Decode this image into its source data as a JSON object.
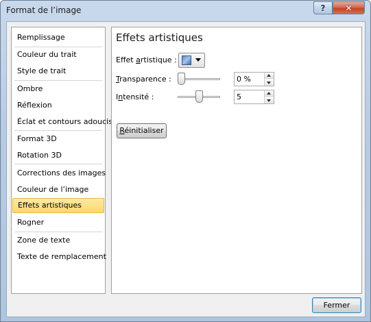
{
  "window": {
    "title": "Format de l’image",
    "help_glyph": "?",
    "close_glyph": "✕"
  },
  "sidebar": {
    "items": [
      {
        "label": "Remplissage",
        "selected": false
      },
      {
        "label": "Couleur du trait",
        "selected": false
      },
      {
        "label": "Style de trait",
        "selected": false
      },
      {
        "label": "Ombre",
        "selected": false
      },
      {
        "label": "Réflexion",
        "selected": false
      },
      {
        "label": "Éclat et contours adoucis",
        "selected": false
      },
      {
        "label": "Format 3D",
        "selected": false
      },
      {
        "label": "Rotation 3D",
        "selected": false
      },
      {
        "label": "Corrections des images",
        "selected": false
      },
      {
        "label": "Couleur de l’image",
        "selected": false
      },
      {
        "label": "Effets artistiques",
        "selected": true
      },
      {
        "label": "Rogner",
        "selected": false
      },
      {
        "label": "Zone de texte",
        "selected": false
      },
      {
        "label": "Texte de remplacement",
        "selected": false
      }
    ]
  },
  "panel": {
    "title": "Effets artistiques",
    "effect": {
      "label_pre": "Effet ",
      "label_access": "a",
      "label_post": "rtistique :",
      "icon": "picture-effect-icon"
    },
    "transparency": {
      "label_access": "T",
      "label_post": "ransparence :",
      "value": "0 %",
      "level": 0.0
    },
    "intensity": {
      "label_pre": "I",
      "label_access": "n",
      "label_post": "tensité :",
      "value": "5",
      "level": 0.5
    },
    "reset": {
      "label_access": "R",
      "label_post": "éinitialiser"
    }
  },
  "footer": {
    "close_label": "Fermer"
  },
  "colors": {
    "selection": "#fbd969",
    "titlebar": "#b7cbe4",
    "close_button": "#c2442a"
  }
}
